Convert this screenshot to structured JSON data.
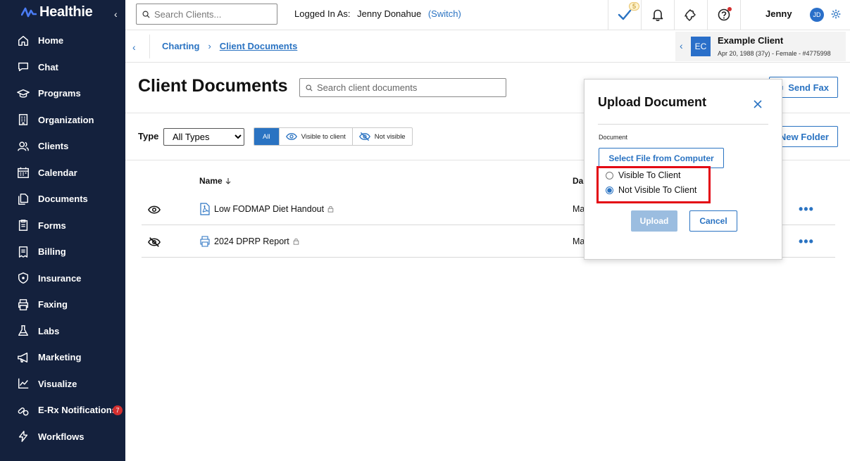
{
  "app": {
    "brand": "Healthie"
  },
  "sidebar": {
    "items": [
      {
        "label": "Home",
        "icon": "home-icon"
      },
      {
        "label": "Chat",
        "icon": "chat-icon"
      },
      {
        "label": "Programs",
        "icon": "graduation-cap-icon"
      },
      {
        "label": "Organization",
        "icon": "building-icon"
      },
      {
        "label": "Clients",
        "icon": "users-icon"
      },
      {
        "label": "Calendar",
        "icon": "calendar-icon"
      },
      {
        "label": "Documents",
        "icon": "documents-icon"
      },
      {
        "label": "Forms",
        "icon": "clipboard-icon"
      },
      {
        "label": "Billing",
        "icon": "billing-icon"
      },
      {
        "label": "Insurance",
        "icon": "shield-icon"
      },
      {
        "label": "Faxing",
        "icon": "printer-icon"
      },
      {
        "label": "Labs",
        "icon": "flask-icon"
      },
      {
        "label": "Marketing",
        "icon": "megaphone-icon"
      },
      {
        "label": "Visualize",
        "icon": "chart-icon"
      },
      {
        "label": "E-Rx Notifications",
        "icon": "pills-icon",
        "badge": "7"
      },
      {
        "label": "Workflows",
        "icon": "bolt-icon"
      }
    ]
  },
  "topbar": {
    "search_placeholder": "Search Clients...",
    "logged_in_label": "Logged In As:",
    "user_full_name": "Jenny Donahue",
    "switch_label": "(Switch)",
    "tasks_count": "5",
    "user_first_name": "Jenny",
    "user_initials": "JD"
  },
  "breadcrumb": {
    "items": [
      "Charting",
      "Client Documents"
    ]
  },
  "client": {
    "initials": "EC",
    "name": "Example Client",
    "meta": "Apr 20, 1988 (37y) - Female - #4775998"
  },
  "page": {
    "title": "Client Documents",
    "search_placeholder": "Search client documents",
    "send_fax_label": "Send Fax",
    "new_folder_label": "New Folder"
  },
  "filters": {
    "type_label": "Type",
    "type_selected": "All Types",
    "visibility": [
      "All",
      "Visible to client",
      "Not visible"
    ]
  },
  "table": {
    "columns": [
      "Name",
      "Da"
    ],
    "rows": [
      {
        "name": "Low FODMAP Diet Handout",
        "date": "Ma",
        "visibility": "visible",
        "file_icon": "pdf-icon"
      },
      {
        "name": "2024 DPRP Report",
        "date": "Ma",
        "visibility": "hidden",
        "file_icon": "print-file-icon"
      }
    ]
  },
  "modal": {
    "title": "Upload Document",
    "document_label": "Document",
    "select_file_label": "Select File from Computer",
    "options": [
      "Visible To Client",
      "Not Visible To Client"
    ],
    "selected_option": "Not Visible To Client",
    "upload_label": "Upload",
    "cancel_label": "Cancel"
  },
  "colors": {
    "sidebar_bg": "#14213d",
    "accent": "#2a73c2",
    "highlight": "#e30613",
    "disabled_button": "#9bbde0"
  }
}
